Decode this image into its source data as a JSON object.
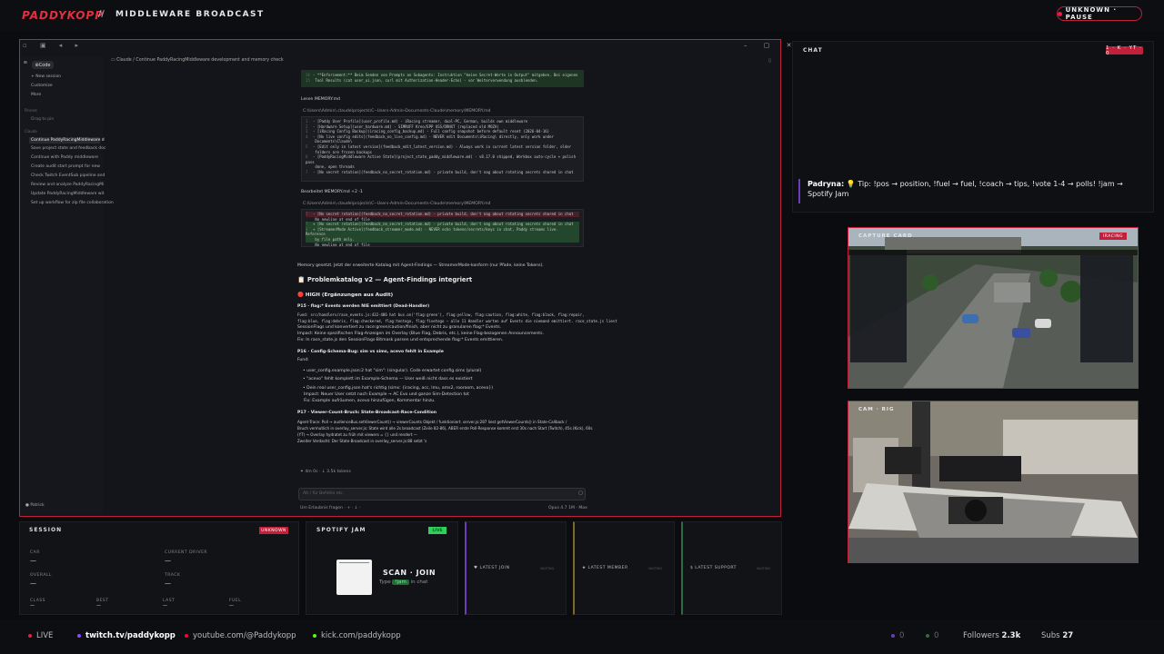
{
  "header": {
    "logo": "PADDYKOPP",
    "separator": "//",
    "title": "MIDDLEWARE BROADCAST",
    "status": "UNKNOWN · PAUSE"
  },
  "app": {
    "code_tab": "Code",
    "breadcrumb": "Claude / Continue PaddyRacingMiddleware development and memory check",
    "sidebar": {
      "new_session": "New session",
      "customize": "Customize",
      "more": "More",
      "pinned_head": "Pinned",
      "pinned_item": "Drag to pin",
      "claude_head": "Claude",
      "items": [
        "Continue PaddyRacingMiddleware d",
        "Save project state and feedback doc",
        "Continue with Paddy middleware",
        "Create audit start prompt for new",
        "Check Twitch EventSub pipeline and",
        "Review and analyze PaddyRacingMi",
        "Update PaddyRacingMiddleware wit",
        "Set up workflow for zip file collaboration"
      ],
      "user": "Patrick"
    },
    "code1": {
      "line_a": "- **Enforcement:** Beim Senden von Prompts an Subagents: Instruktion \"keine Secret-Werte in Output\" mitgeben. Bei eigenen",
      "line_b": "  Tool Results (cat user_ui.json, curl mit Authorization-Header-Echo) - vor Weiterverwendung ausblenden."
    },
    "read_label": "Lesen MEMORY.md",
    "path1": "C:\\Users\\Admin\\.claude\\projects\\C--Users-Admin-Documents-Claude\\memory\\MEMORY.md",
    "memory_lines": [
      "- [Paddy User Profile](user_profile.md) - iRacing streamer, dual-PC, German, builds own middleware",
      "- [Hardware Setup](user_hardware.md) - SIMRUFF Kreo/EPP USS/DRNXT (replaced old MOZA)",
      "- [iRacing Config Backup](iracing_config_backup.md) - Full config snapshot before default reset (2026-04-16)",
      "- [No live config edits](feedback_no_live_config.md) - NEVER edit Documents\\iRacing\\ directly, only work under",
      "  Documents\\Claude\\",
      "- [Edit only in latest version](feedback_edit_latest_version.md) - Always work in current latest version folder, older",
      "  folders are frozen backups",
      "- [PaddyRacingMiddleware Active State](project_state_paddy_middleware.md) - v8.17.0 shipped, Workbox auto-cycle + polish pass",
      "  done, open threads",
      "- [No secret rotation](feedback_no_secret_rotation.md) - private build, don't nag about rotating secrets shared in chat"
    ],
    "edit_label": "Bearbeitet MEMORY.md +2 -1",
    "path2": "C:\\Users\\Admin\\.claude\\projects\\C--Users-Admin-Documents-Claude\\memory\\MEMORY.md",
    "diff_lines": [
      "- [No secret rotation](feedback_no_secret_rotation.md) - private build, don't nag about rotating secrets shared in chat",
      "  No newline at end of file",
      "+ [No secret rotation](feedback_no_secret_rotation.md) - private build, don't nag about rotating secrets shared in chat",
      "+ [StreamerMode Active](feedback_streamer_mode.md) - NEVER echo tokens/secrets/keys in chat, Paddy streams live. Reference",
      "  by file path only.",
      "  No newline at end of file"
    ],
    "memory_note": "Memory gesetzt. Jetzt der erweiterte Katalog mit Agent-Findings — StreamerMode-konform (nur Pfade, keine Tokens).",
    "catalog_title": "📋 Problemkatalog v2 — Agent-Findings integriert",
    "high_title": "🔴 HIGH (Ergänzungen aus Audit)",
    "p15_title": "P15 · flag:* Events werden NIE emittiert (Dead-Handler)",
    "p15_l1": "Fund: src/handlers/race_events.js:432-486 hat bus.on('flag:green'), flag:yellow, flag:caution, flag:white, flag:black, flag:repair,",
    "p15_l2": "flag:blue, flag:debris, flag:checkered, flag:tentogo, flag:fivetogo — alle 11 Handler warten auf Events die niemand emittiert. race_state.js liest",
    "p15_l3": "SessionFlags und konvertiert zu race:green/caution/finish, aber nicht zu granularen flag:* Events.",
    "p15_l4": "Impact: Keine spezifischen Flag-Anzeigen im Overlay (Blue Flag, Debris, etc.), keine Flag-bezogenen Announcements.",
    "p15_l5": "Fix: In race_state.js den SessionFlags-Bitmask parsen und entsprechende flag:* Events emittieren.",
    "p16_title": "P16 · Config-Schema-Bug: sim vs sims, acevo fehlt in Example",
    "fund_label": "Fund:",
    "p16_b1": "user_config.example.json:2 hat \"sim\": (singular). Code erwartet config.sims (plural)",
    "p16_b2": "\"acevo\" fehlt komplett im Example-Schema — User weiß nicht dass es existiert",
    "p16_b3a": "Dein real user_config.json hat's richtig (sims: {iracing, acc, lmu, ams2, rooroom, acevo})",
    "p16_b3b": "Impact: Neuer User setzt nach Example → AC Evo und ganze Sim-Detection tot",
    "p16_b3c": "Fix: Example aufräumen, acevo hinzufügen, Kommentar hinzu.",
    "p17_title": "P17 · Viewer-Count-Bruch: State-Broadcast-Race-Condition",
    "p17_l1": "Agent-Trace: Poll → audienceBus.setViewerCount() → viewerCounts Objekt / funktioniert. server.js:287 liest getViewerCounts() in State-Callback /",
    "p17_l2": "Bruch vermutlich in overlay_server.js: State wird alle 2s broadcast (Zeile 82-86), ABER erste Poll-Response kommt erst 30s nach Start (Twitch), 45s (Kick), 60s",
    "p17_l3": "(YT) → Overlay hydratet zu früh mit viewers = {} und rendert —",
    "p17_l4": "Zweiter Verdacht: Der State-Broadcast in overlay_server.js:88 setzt 's",
    "status_line": "4m 0s · ↓ 3.5k tokens",
    "input_placeholder": "Alt / für Befehle etc.",
    "bottom_left": "Um Erlaubnis fragen",
    "model": "Opus 4.7 1M · Max"
  },
  "chat": {
    "title": "CHAT",
    "badge": "1 · K · YT · 0",
    "username": "Padryna:",
    "message": "💡 Tip: !pos → position, !fuel → fuel, !coach → tips, !vote 1-4 → polls! !jam → Spotify Jam"
  },
  "capture_card": {
    "label": "CAPTURE CARD",
    "badge": "IRACING"
  },
  "cam_rig": {
    "label": "CAM · RIG"
  },
  "session": {
    "title": "SESSION",
    "badge": "UNKNOWN",
    "car_label": "CAR",
    "car_value": "—",
    "driver_label": "CURRENT DRIVER",
    "driver_value": "—",
    "overall_label": "OVERALL",
    "overall_value": "—",
    "track_label": "TRACK",
    "track_value": "—",
    "class_label": "CLASS",
    "class_value": "—",
    "best_label": "BEST",
    "best_value": "—",
    "last_label": "LAST",
    "last_value": "—",
    "fuel_label": "FUEL",
    "fuel_value": "—"
  },
  "spotify": {
    "title": "SPOTIFY JAM",
    "badge": "LIVE",
    "scan": "SCAN · JOIN",
    "type_label": "Type",
    "command": "!jam",
    "in_chat": "in chat"
  },
  "widgets": [
    {
      "label": "LATEST JOIN",
      "value": "WAITING"
    },
    {
      "label": "LATEST MEMBER",
      "value": "WAITING"
    },
    {
      "label": "LATEST SUPPORT",
      "value": "WAITING"
    }
  ],
  "footer": {
    "live": "LIVE",
    "twitch": "twitch.tv/paddykopp",
    "youtube": "youtube.com/@Paddykopp",
    "kick": "kick.com/paddykopp",
    "count_a": "0",
    "count_b": "0",
    "followers_label": "Followers",
    "followers": "2.3k",
    "subs_label": "Subs",
    "subs": "27",
    "colors": {
      "twitch": "#9146ff",
      "youtube": "#ff0033",
      "kick": "#53fc18",
      "accent": "#c0203a"
    }
  }
}
